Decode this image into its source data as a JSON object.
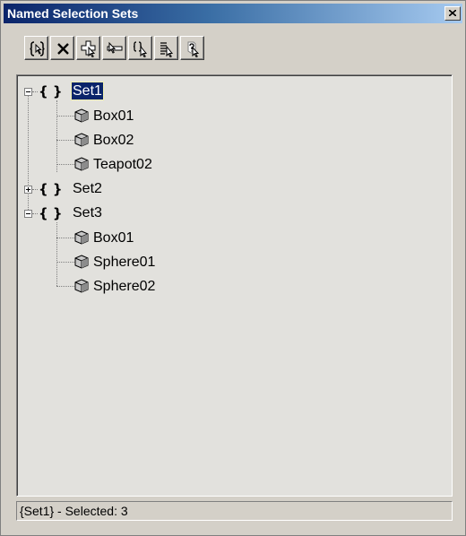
{
  "window": {
    "title": "Named Selection Sets",
    "close_icon": "close-icon"
  },
  "toolbar": {
    "buttons": [
      {
        "icon": "create-set-icon"
      },
      {
        "icon": "delete-icon"
      },
      {
        "icon": "add-objects-icon"
      },
      {
        "icon": "remove-objects-icon"
      },
      {
        "icon": "select-objects-in-set-icon"
      },
      {
        "icon": "select-set-by-name-icon"
      },
      {
        "icon": "highlight-selected-objects-icon"
      }
    ]
  },
  "tree": {
    "sets": [
      {
        "brace": "{ }",
        "name": "Set1",
        "expanded": true,
        "selected": true,
        "objects": [
          "Box01",
          "Box02",
          "Teapot02"
        ]
      },
      {
        "brace": "{ }",
        "name": "Set2",
        "expanded": false,
        "selected": false,
        "objects": []
      },
      {
        "brace": "{ }",
        "name": "Set3",
        "expanded": true,
        "selected": false,
        "objects": [
          "Box01",
          "Sphere01",
          "Sphere02"
        ]
      }
    ],
    "object_icon": "object-icon"
  },
  "status": {
    "text": "{Set1} - Selected: 3"
  }
}
